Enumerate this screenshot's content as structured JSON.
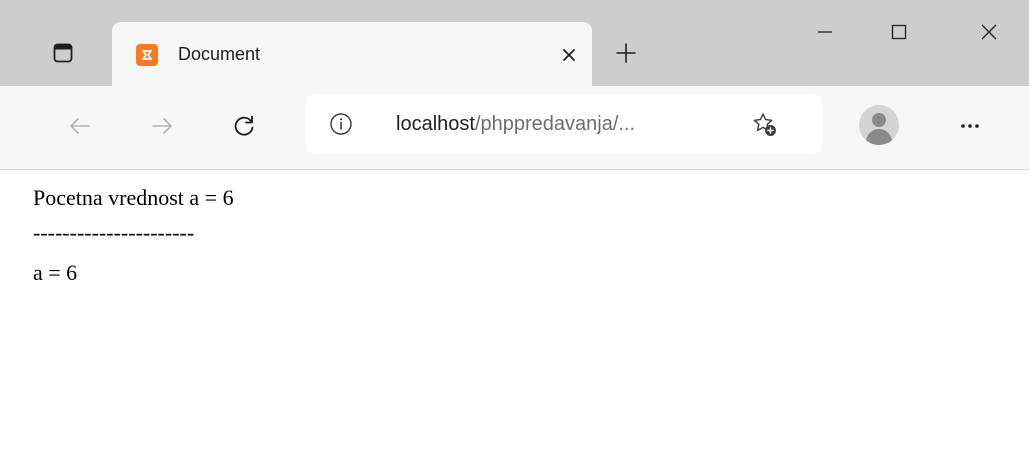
{
  "colors": {
    "tab_strip_bg": "#cdcdcd",
    "toolbar_bg": "#f7f7f7",
    "favicon_orange": "#fb7a24",
    "url_path_gray": "#6e6e6e"
  },
  "icons": {
    "tab_actions": "tab-actions-icon",
    "favicon": "xampp-icon",
    "tab_close": "close-icon",
    "new_tab": "plus-icon",
    "minimize": "minimize-icon",
    "maximize": "maximize-icon",
    "close": "close-icon",
    "back": "back-arrow-icon",
    "forward": "forward-arrow-icon",
    "refresh": "refresh-icon",
    "site_info": "info-icon",
    "add_favorite": "add-favorite-icon",
    "profile": "profile-icon",
    "menu": "more-icon"
  },
  "tab": {
    "title": "Document"
  },
  "address_bar": {
    "host": "localhost",
    "path": "/phppredavanja/..."
  },
  "page": {
    "lines": [
      "Pocetna vrednost a = 6",
      "----------------------",
      "a = 6"
    ]
  }
}
